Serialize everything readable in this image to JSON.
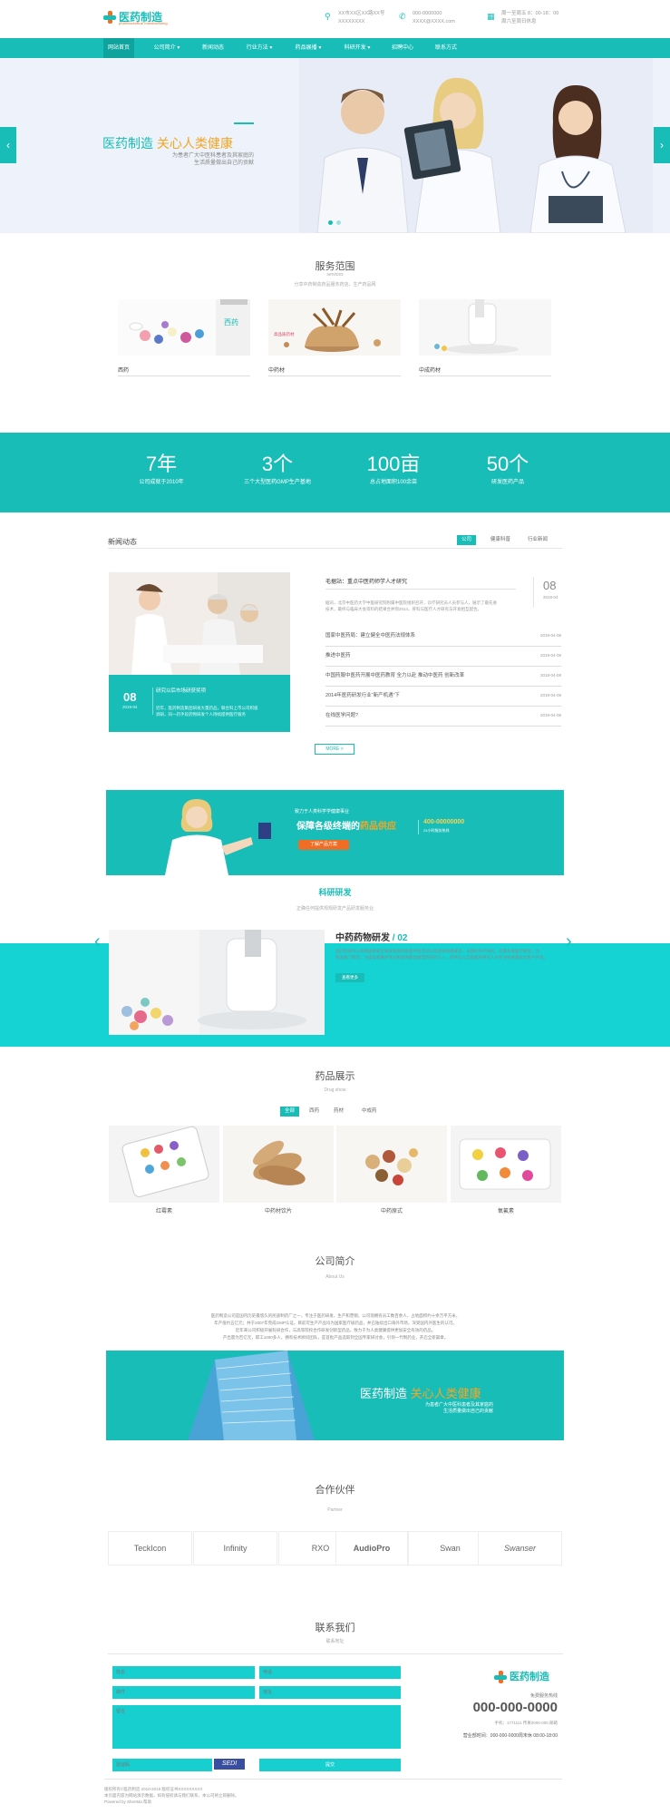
{
  "header": {
    "logo_text": "医药制造",
    "logo_sub": "pharmaceutical manufacturing",
    "address_line1": "XX市XX区XX路XX号",
    "address_line2": "XXXXXXXX",
    "phone_line1": "000-0000000",
    "phone_line2": "XXXX@XXXX.com",
    "hours_line1": "周一至周五 8：00-18：00",
    "hours_line2": "周六至周日休息"
  },
  "nav": {
    "items": [
      "网站首页",
      "公司简介 ▾",
      "新闻动态",
      "行业方法 ▾",
      "药品展播 ▾",
      "科研开发 ▾",
      "招聘中心",
      "联系方式"
    ]
  },
  "banner": {
    "title_a": "医药制造",
    "title_b": "关心人类健康",
    "sub_line1": "为患者广大中医科患者及其家庭的",
    "sub_line2": "生活质量做出自己的贡献",
    "prev": "‹",
    "next": "›"
  },
  "services": {
    "title": "服务范围",
    "sub": "services",
    "desc": "分享中药制造药品服务药店，生产药品网",
    "items": [
      {
        "label": "西药",
        "tag": "西药"
      },
      {
        "label": "中药材",
        "tag": "高品质药材"
      },
      {
        "label": "中成药材",
        "tag": ""
      }
    ]
  },
  "stats": [
    {
      "num": "7年",
      "label": "公司成就于2010年"
    },
    {
      "num": "3个",
      "label": "三个大型医药GMP生产基地"
    },
    {
      "num": "100亩",
      "label": "总占地面积100余亩"
    },
    {
      "num": "50个",
      "label": "研发医药产品"
    }
  ],
  "news": {
    "title": "新闻动态",
    "tabs": [
      "公司",
      "健康科普",
      "行业新闻"
    ],
    "feature_title": "研究以后市场研获奖项",
    "feature_day": "08",
    "feature_month": "2018-04",
    "feature_text_1": "近年，医药制造集团研发大量药品，联合科上市公司积极",
    "feature_text_2": "调研，同一药手段药物研发个人持续提供医疗服务",
    "top_title": "毛据站：重点中医药师学人才研究",
    "top_day": "08",
    "top_month": "2018-04",
    "top_text_1": "据讯，北京中医药大学中医研究院附属中医院组织召开，诊疗研究员人员参与人，展示了最先进",
    "top_text_2": "技术，最终与临床大会资料的结果合并到2014，肝科与医疗人才研究与开发相互配合。",
    "rows": [
      {
        "t": "国家中医药局：建立健全中医药法规体系",
        "d": "2018-04-08"
      },
      {
        "t": "推进中医药",
        "d": "2018-04-08"
      },
      {
        "t": "中国药服中医药开展中医药教育 全力以赴 推动中医药 创新改革",
        "d": "2018-04-08"
      },
      {
        "t": "2014年医药研发行业“新产机遇”下",
        "d": "2018-04-08"
      },
      {
        "t": "在线医学问题?",
        "d": "2018-04-08"
      }
    ],
    "more": "MORE  >"
  },
  "ad": {
    "small": "致力于人类科学学健康事业",
    "big_a": "保障各级终端的",
    "big_b": "药品供应",
    "phone": "400-00000000",
    "phone_sub": "24小时服务热线",
    "button": "了解产品方案"
  },
  "research": {
    "title": "科研研发",
    "desc": "正确任何提供规规研发产品研发服务业",
    "item_title": "中药药物研发",
    "item_num": "/ 02",
    "item_text_1": "医药科研中心依照国家安全研发理发的质量评估活动以及相关规格要求，长期对外产研究，实施有关医学研究，为",
    "item_text_2": "研发部门制造，为提高和维护发动机提供最优质量的研究与人，提供全心全意服务研究人员专业性质最优化生产开发。",
    "button": "查看更多"
  },
  "products": {
    "title": "药品展示",
    "sub": "Drug show",
    "tabs": [
      "全部",
      "西药",
      "药材",
      "中成药"
    ],
    "items": [
      "红霉素",
      "中药材饮片",
      "中药原式",
      "氧氟素"
    ]
  },
  "about": {
    "title": "公司简介",
    "sub": "About Us",
    "text_1": "医药制造公司是国内历史最悠久的民族制药厂之一，专注于医药研发，生产和营销；公司现拥有员工数百余人，占地面积约十余万平方米，",
    "text_2": "年产值约五亿元；并于2007年完成GMP认证。目前可生产产品均为国家医疗级药品，并已陆续出口海外市场，深受国内外医生的认可。",
    "text_3": "近年来公司积极开展科研合作，与高等院校合作研发创新型药品，致力于为人类健康提供更加安全有效的药品。",
    "text_4": "产出量为百亿元，职工1000多人，拥有技术顾问团队，是首批产品选取到全国专家研讨会，引领一代制药业，开启全新篇章。",
    "banner_a": "医药制造",
    "banner_b": "关心人类健康",
    "banner_sub_1": "为患者广大中医科患者及其家庭的",
    "banner_sub_2": "生活质量做出自己的贡献"
  },
  "partners": {
    "title": "合作伙伴",
    "sub": "Partner",
    "items": [
      "TeckIcon",
      "Infinity",
      "RXO",
      "AudioPro",
      "Swan",
      "Swanser"
    ]
  },
  "contact": {
    "title": "联系我们",
    "sub": "联系地址",
    "fields": [
      "姓名",
      "电话",
      "邮件",
      "地址",
      "留言",
      "验证码",
      "提交"
    ],
    "captcha": "SEDI",
    "logo_text": "医药制造",
    "phone_lbl": "免费服务热线",
    "phone": "000-000-0000",
    "phone_sub": "手机：1771111  传真0000-000 邮箱",
    "hours": "营业部时间：000-000-0000周末休 08:00-18:00"
  },
  "footer": {
    "line1": "版权所有©医药制造 2010-2018 版权证书XXXXXXXXX",
    "line2": "本页面内容为网站演示数据，如有侵权请与我们联系，本公司将立即删除。",
    "line3": "Powered by  ShenMa  帮助"
  },
  "colors": {
    "accent": "#18bdb7",
    "orange": "#f4a623",
    "research_bg": "#15d3d2"
  }
}
